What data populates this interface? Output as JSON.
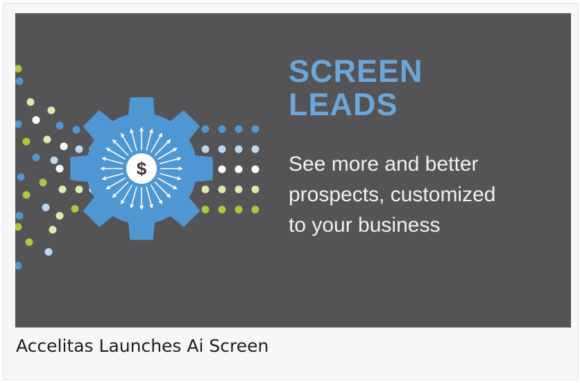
{
  "banner": {
    "headline": [
      "SCREEN",
      "LEADS"
    ],
    "tagline": [
      "See more and better",
      "prospects, customized",
      "to your business"
    ],
    "gear_symbol": "$",
    "colors": {
      "background": "#545456",
      "headline": "#6aa6d8",
      "gear": "#4f97d3",
      "dot_blue": "#4f97d3",
      "dot_light_blue": "#bcd7ef",
      "dot_white": "#ffffff",
      "dot_light_green": "#dce9b0",
      "dot_green": "#a8c93e"
    }
  },
  "caption": "Accelitas Launches Ai Screen"
}
